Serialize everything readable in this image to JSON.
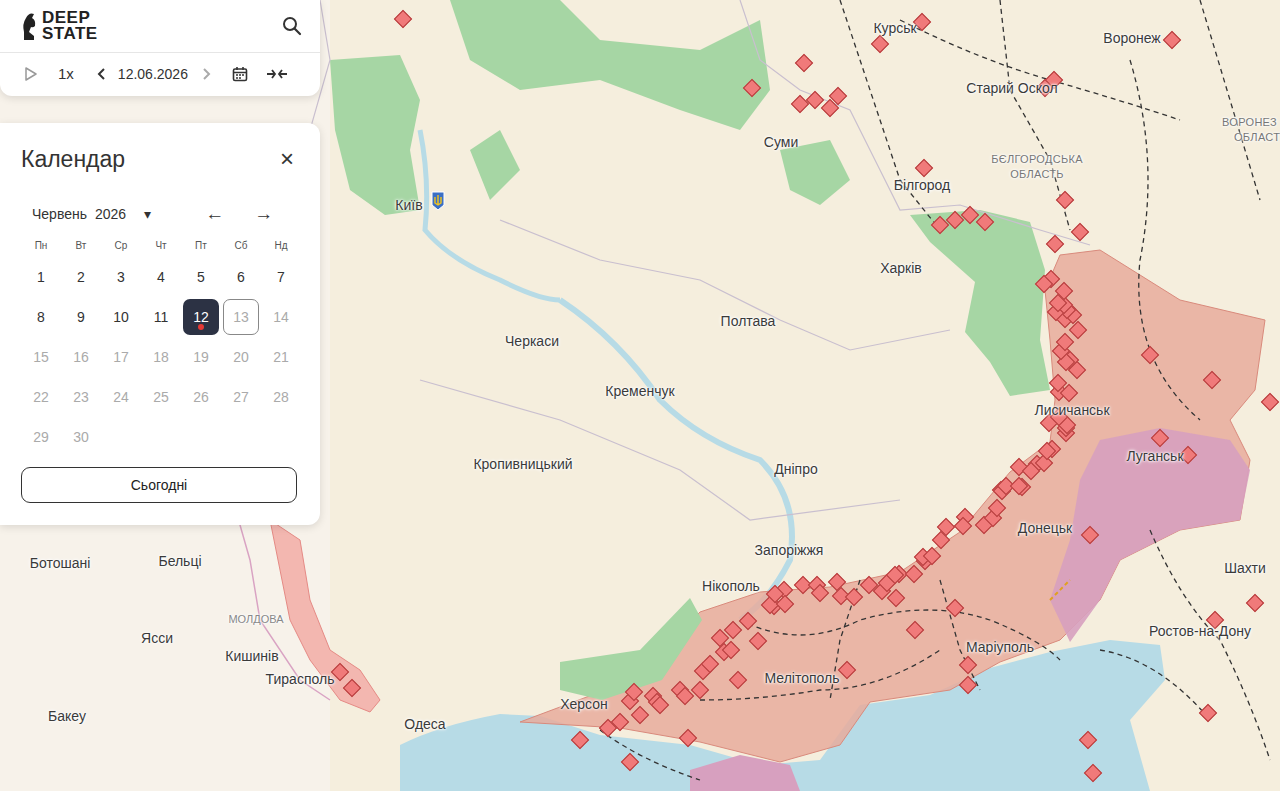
{
  "header": {
    "logo": [
      "DEEP",
      "STATE"
    ]
  },
  "controls": {
    "speed": "1x",
    "date": "12.06.2026"
  },
  "calendar": {
    "title": "Календар",
    "close": "×",
    "month": "Червень",
    "year": "2026",
    "caret": "▾",
    "prev": "←",
    "next": "→",
    "weekdays": [
      "Пн",
      "Вт",
      "Ср",
      "Чт",
      "Пт",
      "Сб",
      "Нд"
    ],
    "days": [
      {
        "label": "1",
        "selected": false,
        "today": false,
        "disabled": false,
        "marked": false
      },
      {
        "label": "2",
        "selected": false,
        "today": false,
        "disabled": false,
        "marked": false
      },
      {
        "label": "3",
        "selected": false,
        "today": false,
        "disabled": false,
        "marked": false
      },
      {
        "label": "4",
        "selected": false,
        "today": false,
        "disabled": false,
        "marked": false
      },
      {
        "label": "5",
        "selected": false,
        "today": false,
        "disabled": false,
        "marked": false
      },
      {
        "label": "6",
        "selected": false,
        "today": false,
        "disabled": false,
        "marked": false
      },
      {
        "label": "7",
        "selected": false,
        "today": false,
        "disabled": false,
        "marked": false
      },
      {
        "label": "8",
        "selected": false,
        "today": false,
        "disabled": false,
        "marked": false
      },
      {
        "label": "9",
        "selected": false,
        "today": false,
        "disabled": false,
        "marked": false
      },
      {
        "label": "10",
        "selected": false,
        "today": false,
        "disabled": false,
        "marked": false
      },
      {
        "label": "11",
        "selected": false,
        "today": false,
        "disabled": false,
        "marked": false
      },
      {
        "label": "12",
        "selected": true,
        "today": false,
        "disabled": false,
        "marked": true
      },
      {
        "label": "13",
        "selected": false,
        "today": true,
        "disabled": true,
        "marked": false
      },
      {
        "label": "14",
        "selected": false,
        "today": false,
        "disabled": true,
        "marked": false
      },
      {
        "label": "15",
        "selected": false,
        "today": false,
        "disabled": true,
        "marked": false
      },
      {
        "label": "16",
        "selected": false,
        "today": false,
        "disabled": true,
        "marked": false
      },
      {
        "label": "17",
        "selected": false,
        "today": false,
        "disabled": true,
        "marked": false
      },
      {
        "label": "18",
        "selected": false,
        "today": false,
        "disabled": true,
        "marked": false
      },
      {
        "label": "19",
        "selected": false,
        "today": false,
        "disabled": true,
        "marked": false
      },
      {
        "label": "20",
        "selected": false,
        "today": false,
        "disabled": true,
        "marked": false
      },
      {
        "label": "21",
        "selected": false,
        "today": false,
        "disabled": true,
        "marked": false
      },
      {
        "label": "22",
        "selected": false,
        "today": false,
        "disabled": true,
        "marked": false
      },
      {
        "label": "23",
        "selected": false,
        "today": false,
        "disabled": true,
        "marked": false
      },
      {
        "label": "24",
        "selected": false,
        "today": false,
        "disabled": true,
        "marked": false
      },
      {
        "label": "25",
        "selected": false,
        "today": false,
        "disabled": true,
        "marked": false
      },
      {
        "label": "26",
        "selected": false,
        "today": false,
        "disabled": true,
        "marked": false
      },
      {
        "label": "27",
        "selected": false,
        "today": false,
        "disabled": true,
        "marked": false
      },
      {
        "label": "28",
        "selected": false,
        "today": false,
        "disabled": true,
        "marked": false
      },
      {
        "label": "29",
        "selected": false,
        "today": false,
        "disabled": true,
        "marked": false
      },
      {
        "label": "30",
        "selected": false,
        "today": false,
        "disabled": true,
        "marked": false
      }
    ],
    "today_button": "Сьогодні"
  },
  "map": {
    "labels": [
      {
        "text": "Курськ",
        "kind": "city"
      },
      {
        "text": "Воронеж",
        "kind": "city"
      },
      {
        "text": "Старий Оскол",
        "kind": "city"
      },
      {
        "text": "Суми",
        "kind": "city"
      },
      {
        "text": "Білгород",
        "kind": "city"
      },
      {
        "text": "БЄЛГОРОДСЬКА",
        "kind": "region"
      },
      {
        "text": "ОБЛАСТЬ",
        "kind": "region"
      },
      {
        "text": "ВОРОНЕЗ",
        "kind": "region"
      },
      {
        "text": "ОБЛАСТ",
        "kind": "region"
      },
      {
        "text": "Київ",
        "kind": "city"
      },
      {
        "text": "Харків",
        "kind": "city"
      },
      {
        "text": "Полтава",
        "kind": "city"
      },
      {
        "text": "Черкаси",
        "kind": "city"
      },
      {
        "text": "Кременчук",
        "kind": "city"
      },
      {
        "text": "Кропивницький",
        "kind": "city"
      },
      {
        "text": "Дніпро",
        "kind": "city"
      },
      {
        "text": "Запоріжжя",
        "kind": "city"
      },
      {
        "text": "Нікополь",
        "kind": "city"
      },
      {
        "text": "Херсон",
        "kind": "city"
      },
      {
        "text": "Мелітополь",
        "kind": "city"
      },
      {
        "text": "Маріуполь",
        "kind": "city"
      },
      {
        "text": "Лисичанськ",
        "kind": "city"
      },
      {
        "text": "Луганськ",
        "kind": "city"
      },
      {
        "text": "Донецьк",
        "kind": "city"
      },
      {
        "text": "Шахти",
        "kind": "city"
      },
      {
        "text": "Ростов-на-Дону",
        "kind": "city"
      },
      {
        "text": "Одеса",
        "kind": "city"
      },
      {
        "text": "Тирасполь",
        "kind": "city"
      },
      {
        "text": "Кишинів",
        "kind": "city"
      },
      {
        "text": "Ясси",
        "kind": "city"
      },
      {
        "text": "Бельці",
        "kind": "city"
      },
      {
        "text": "Ботошані",
        "kind": "city"
      },
      {
        "text": "Бакеу",
        "kind": "city"
      },
      {
        "text": "МОЛДОВА",
        "kind": "country"
      }
    ]
  }
}
